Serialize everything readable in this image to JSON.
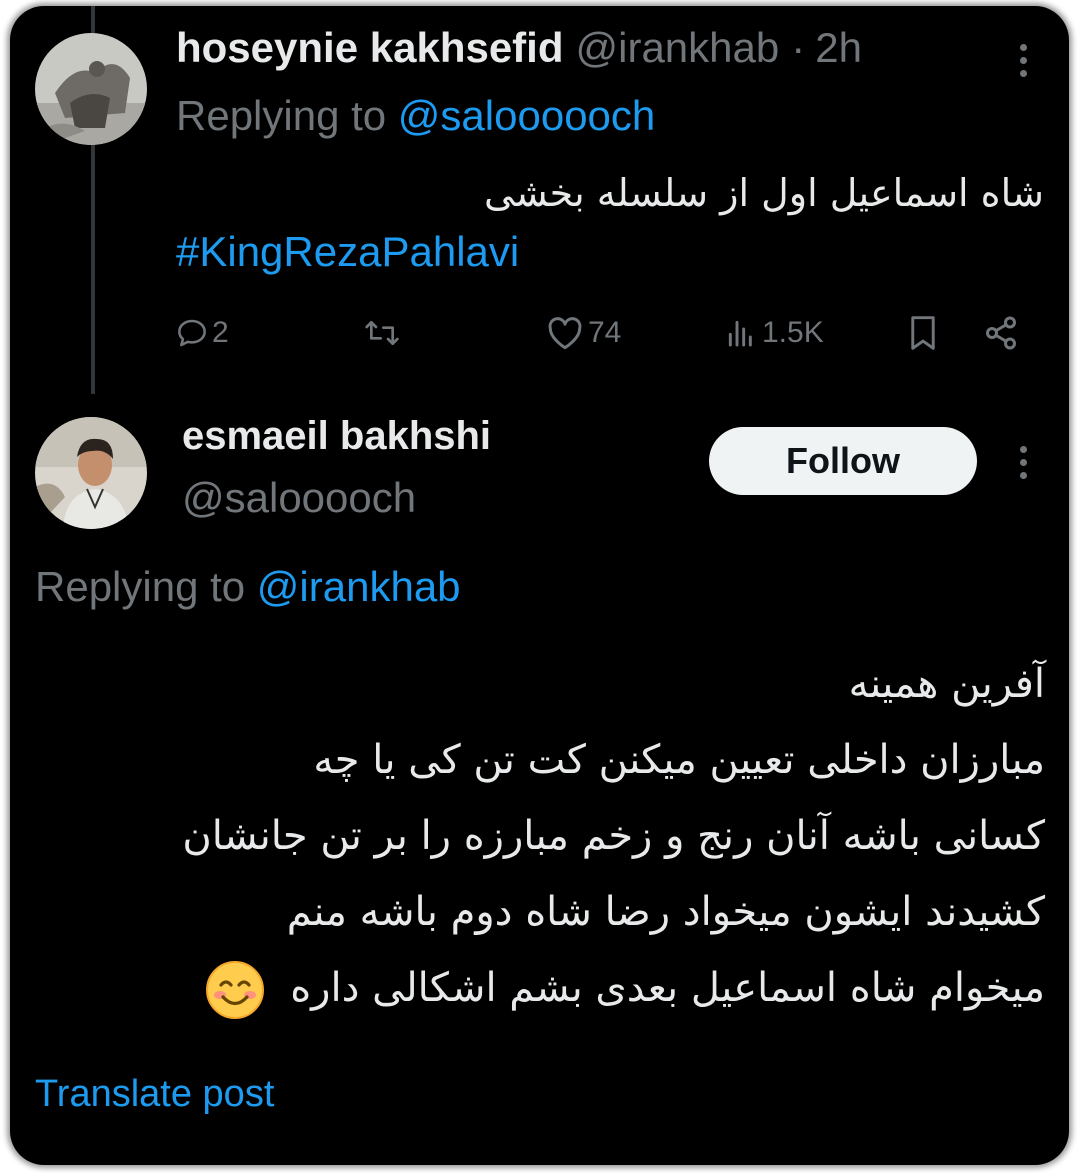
{
  "tweet1": {
    "display_name": "hoseynie kakhsefid",
    "handle": "@irankhab",
    "separator": "·",
    "time": "2h",
    "replying_label": "Replying to ",
    "replying_handle": "@saloooooch",
    "text": "شاه اسماعیل اول از سلسله بخشی",
    "hashtag": "#KingRezaPahlavi",
    "stats": {
      "replies": "2",
      "likes": "74",
      "views": "1.5K"
    }
  },
  "tweet2": {
    "display_name": "esmaeil bakhshi",
    "handle": "@salooooch",
    "follow_label": "Follow",
    "replying_label": "Replying to ",
    "replying_handle": "@irankhab",
    "lines": [
      "آفرین همینه",
      "مبارزان داخلی تعیین میکنن کت تن کی یا چه",
      "کسانی باشه آنان رنج و زخم مبارزه را بر تن جانشان",
      "کشیدند ایشون میخواد رضا شاه دوم باشه منم",
      "میخوام شاه اسماعیل بعدی بشم اشکالی داره"
    ],
    "emoji": "😊",
    "translate_label": "Translate post"
  },
  "colors": {
    "background": "#000000",
    "text": "#e7e9ea",
    "muted": "#71767b",
    "accent": "#1d9bf0",
    "follow_bg": "#eff3f4"
  },
  "icons": [
    "reply-icon",
    "retweet-icon",
    "like-icon",
    "views-icon",
    "bookmark-icon",
    "share-icon",
    "more-icon"
  ]
}
